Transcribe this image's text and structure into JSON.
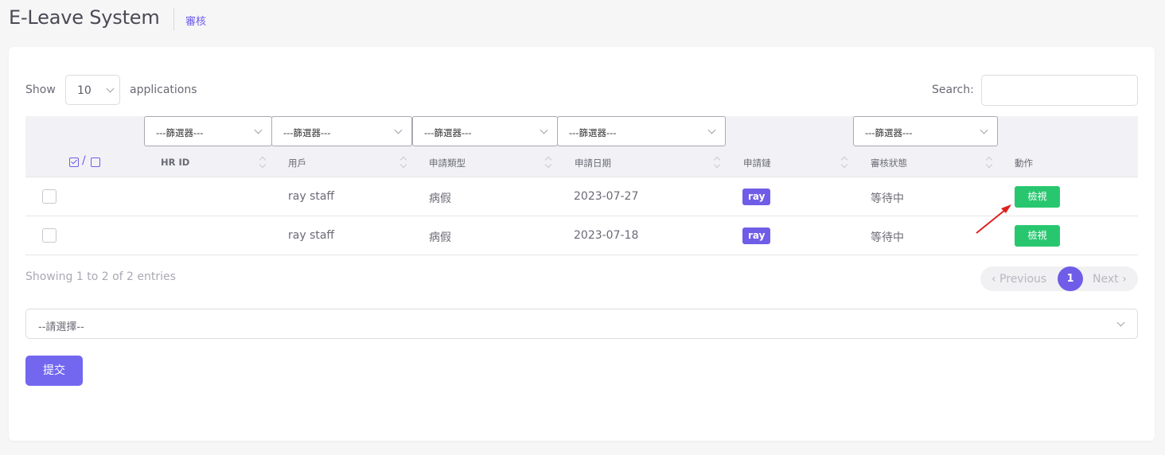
{
  "header": {
    "title": "E-Leave System",
    "breadcrumb": "審核"
  },
  "toolbar": {
    "show_label": "Show",
    "page_size": "10",
    "applications_label": "applications",
    "search_label": "Search:",
    "search_value": ""
  },
  "filters": [
    "---篩選器---",
    "---篩選器---",
    "---篩選器---",
    "---篩選器---",
    "---篩選器---"
  ],
  "table": {
    "columns": [
      "HR ID",
      "用戶",
      "申請類型",
      "申請日期",
      "申請鏈",
      "審核狀態",
      "動作"
    ],
    "select_slash": "/",
    "rows": [
      {
        "hr_id": "",
        "user": "ray staff",
        "type": "病假",
        "date": "2023-07-27",
        "chain": "ray",
        "status": "等待中",
        "action": "檢視"
      },
      {
        "hr_id": "",
        "user": "ray staff",
        "type": "病假",
        "date": "2023-07-18",
        "chain": "ray",
        "status": "等待中",
        "action": "檢視"
      }
    ]
  },
  "footer": {
    "info": "Showing 1 to 2 of 2 entries",
    "prev": "‹ Previous",
    "current_page": "1",
    "next": "Next ›"
  },
  "bulk": {
    "placeholder": "--請選擇--",
    "submit": "提交"
  },
  "colors": {
    "accent": "#7367f0",
    "success": "#28c76f",
    "annotation_arrow": "#e0201b"
  }
}
